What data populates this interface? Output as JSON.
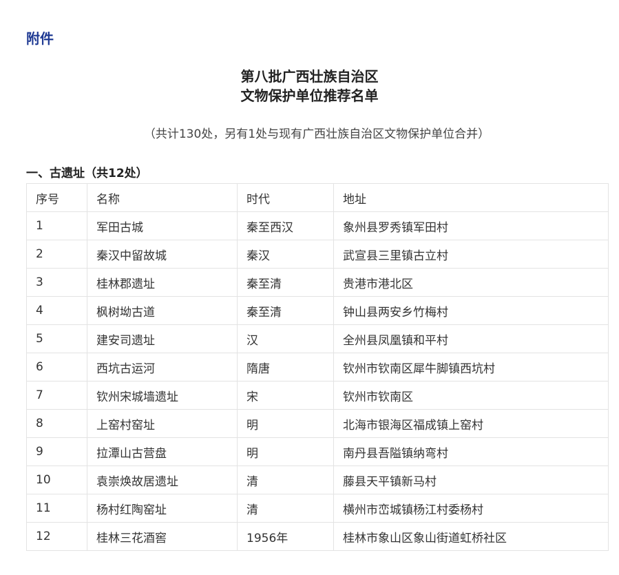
{
  "attachment_label": "附件",
  "title_line1": "第八批广西壮族自治区",
  "title_line2": "文物保护单位推荐名单",
  "note": "（共计130处，另有1处与现有广西壮族自治区文物保护单位合并）",
  "section_heading": "一、古遗址（共12处）",
  "table": {
    "headers": [
      "序号",
      "名称",
      "时代",
      "地址"
    ],
    "rows": [
      [
        "1",
        "军田古城",
        "秦至西汉",
        "象州县罗秀镇军田村"
      ],
      [
        "2",
        "秦汉中留故城",
        "秦汉",
        "武宣县三里镇古立村"
      ],
      [
        "3",
        "桂林郡遗址",
        "秦至清",
        "贵港市港北区"
      ],
      [
        "4",
        "枫树坳古道",
        "秦至清",
        "钟山县两安乡竹梅村"
      ],
      [
        "5",
        "建安司遗址",
        "汉",
        "全州县凤凰镇和平村"
      ],
      [
        "6",
        "西坑古运河",
        "隋唐",
        "钦州市钦南区犀牛脚镇西坑村"
      ],
      [
        "7",
        "钦州宋城墙遗址",
        "宋",
        "钦州市钦南区"
      ],
      [
        "8",
        "上窑村窑址",
        "明",
        "北海市银海区福成镇上窑村"
      ],
      [
        "9",
        "拉潭山古营盘",
        "明",
        "南丹县吾隘镇纳弯村"
      ],
      [
        "10",
        "袁崇焕故居遗址",
        "清",
        "藤县天平镇新马村"
      ],
      [
        "11",
        "杨村红陶窑址",
        "清",
        "横州市峦城镇杨江村委杨村"
      ],
      [
        "12",
        "桂林三花酒窖",
        "1956年",
        "桂林市象山区象山街道虹桥社区"
      ]
    ]
  }
}
